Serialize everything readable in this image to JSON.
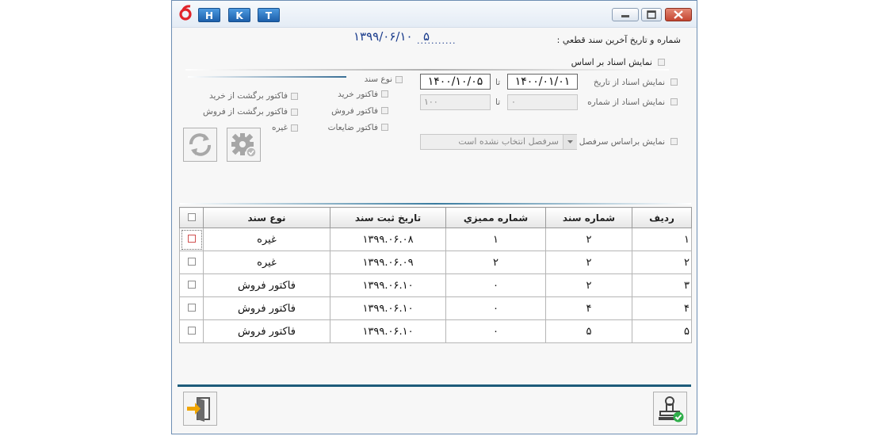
{
  "hkt_buttons": [
    "H",
    "K",
    "T"
  ],
  "window_controls": {
    "minimize": "▭",
    "maximize": "▢",
    "close": "✕"
  },
  "last_doc": {
    "label": "شماره و تاریخ آخرین سند قطعي :",
    "date": "۱۳۹۹/۰۶/۱۰",
    "number": "۵",
    "dots": "..........."
  },
  "filter_by": {
    "label": "نمایش اسناد بر اساس"
  },
  "doc_type": {
    "label": "نوع سند",
    "items": [
      "فاکتور خرید",
      "فاکتور برگشت از خرید",
      "فاکتور فروش",
      "فاکتور برگشت از فروش",
      "فاکتور ضایعات",
      "غیره"
    ]
  },
  "date_filter": {
    "label": "نمایش اسناد از تاریخ",
    "from": "۱۴۰۰/۰۱/۰۱",
    "to_label": "تا",
    "to": "۱۴۰۰/۱۰/۰۵"
  },
  "number_filter": {
    "label": "نمایش اسناد از شماره",
    "from": "۰",
    "to_label": "تا",
    "to": "۱۰۰"
  },
  "heading_filter": {
    "label": "نمایش براساس سرفصل",
    "placeholder": "سرفصل انتخاب نشده است"
  },
  "table": {
    "headers": {
      "row": "ردیف",
      "doc_number": "شماره سند",
      "audit_number": "شماره مميزي",
      "reg_date": "تاریخ ثبت سند",
      "doc_type": "نوع سند"
    },
    "rows": [
      {
        "row": "۱",
        "doc_number": "۲",
        "audit_number": "۱",
        "reg_date": "۱۳۹۹.۰۶.۰۸",
        "doc_type": "غیره"
      },
      {
        "row": "۲",
        "doc_number": "۲",
        "audit_number": "۲",
        "reg_date": "۱۳۹۹.۰۶.۰۹",
        "doc_type": "غیره"
      },
      {
        "row": "۳",
        "doc_number": "۲",
        "audit_number": "۰",
        "reg_date": "۱۳۹۹.۰۶.۱۰",
        "doc_type": "فاکتور فروش"
      },
      {
        "row": "۴",
        "doc_number": "۴",
        "audit_number": "۰",
        "reg_date": "۱۳۹۹.۰۶.۱۰",
        "doc_type": "فاکتور فروش"
      },
      {
        "row": "۵",
        "doc_number": "۵",
        "audit_number": "۰",
        "reg_date": "۱۳۹۹.۰۶.۱۰",
        "doc_type": "فاکتور فروش"
      }
    ]
  },
  "colors": {
    "accent": "#1d5c7a",
    "date_blue": "#1a3c8c",
    "titlebar_btn": "#2a72c4"
  },
  "icons": {
    "logo": "app-logo-icon",
    "refresh": "refresh-icon",
    "settings": "gear-icon",
    "exit": "exit-door-icon",
    "approve": "stamp-approve-icon"
  }
}
